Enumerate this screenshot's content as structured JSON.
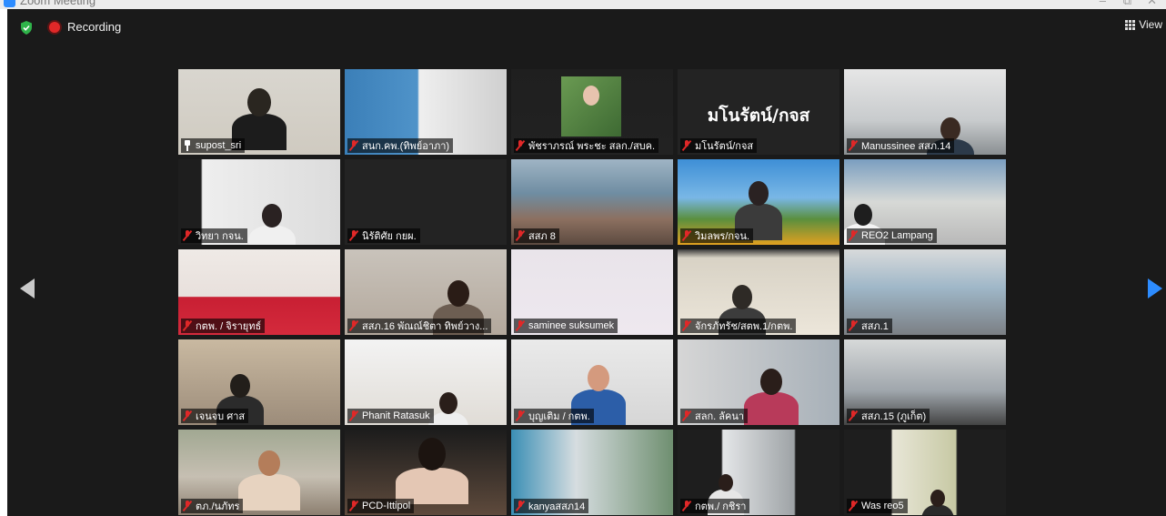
{
  "window": {
    "title": "Zoom Meeting",
    "controls": [
      "–",
      "⧉",
      "✕"
    ]
  },
  "status": {
    "recording_label": "Recording"
  },
  "view_button": {
    "label": "View"
  },
  "participants": [
    {
      "name": "supost_sri",
      "muted": false,
      "pinned": true,
      "active": true
    },
    {
      "name": "สนก.คพ.(ทิพย์อาภา)",
      "muted": true
    },
    {
      "name": "พัชราภรณ์ พระชะ สลก./สบค.",
      "muted": true
    },
    {
      "name": "มโนรัตน์/กจส",
      "muted": true,
      "display_text": "มโนรัตน์/กจส"
    },
    {
      "name": "Manussinee สสภ.14",
      "muted": true
    },
    {
      "name": "วิทยา กจน.",
      "muted": true
    },
    {
      "name": "นิรัติศัย กยผ.",
      "muted": true
    },
    {
      "name": "สสภ 8",
      "muted": true
    },
    {
      "name": "วิมลพร/กจน.",
      "muted": true
    },
    {
      "name": "REO2 Lampang",
      "muted": true
    },
    {
      "name": "กตพ. / จิรายุทธ์",
      "muted": true
    },
    {
      "name": "สสภ.16 พัณณ์ชิตา ทิพย์วาง...",
      "muted": true
    },
    {
      "name": "saminee suksumek",
      "muted": true
    },
    {
      "name": "จักรภัทรัช/สตพ.1/กตพ.",
      "muted": true
    },
    {
      "name": "สสภ.1",
      "muted": true
    },
    {
      "name": "เจนจบ ศาส",
      "muted": true
    },
    {
      "name": "Phanit Ratasuk",
      "muted": true
    },
    {
      "name": "บุญเติม / กตพ.",
      "muted": true
    },
    {
      "name": "สลก. ลัคนา",
      "muted": true
    },
    {
      "name": "สสภ.15 (ภูเก็ต)",
      "muted": true
    },
    {
      "name": "ตภ./นภัทร",
      "muted": true
    },
    {
      "name": "PCD-Ittipol",
      "muted": true
    },
    {
      "name": "kanyaสสภ14",
      "muted": true
    },
    {
      "name": "กตพ./ กชิรา",
      "muted": true
    },
    {
      "name": "Was reo5",
      "muted": true
    }
  ],
  "colors": {
    "accent": "#2d8cff",
    "active_speaker": "#d8ea6a",
    "recording": "#e02828",
    "muted_mic": "#e02828",
    "secure": "#2fb34a"
  }
}
